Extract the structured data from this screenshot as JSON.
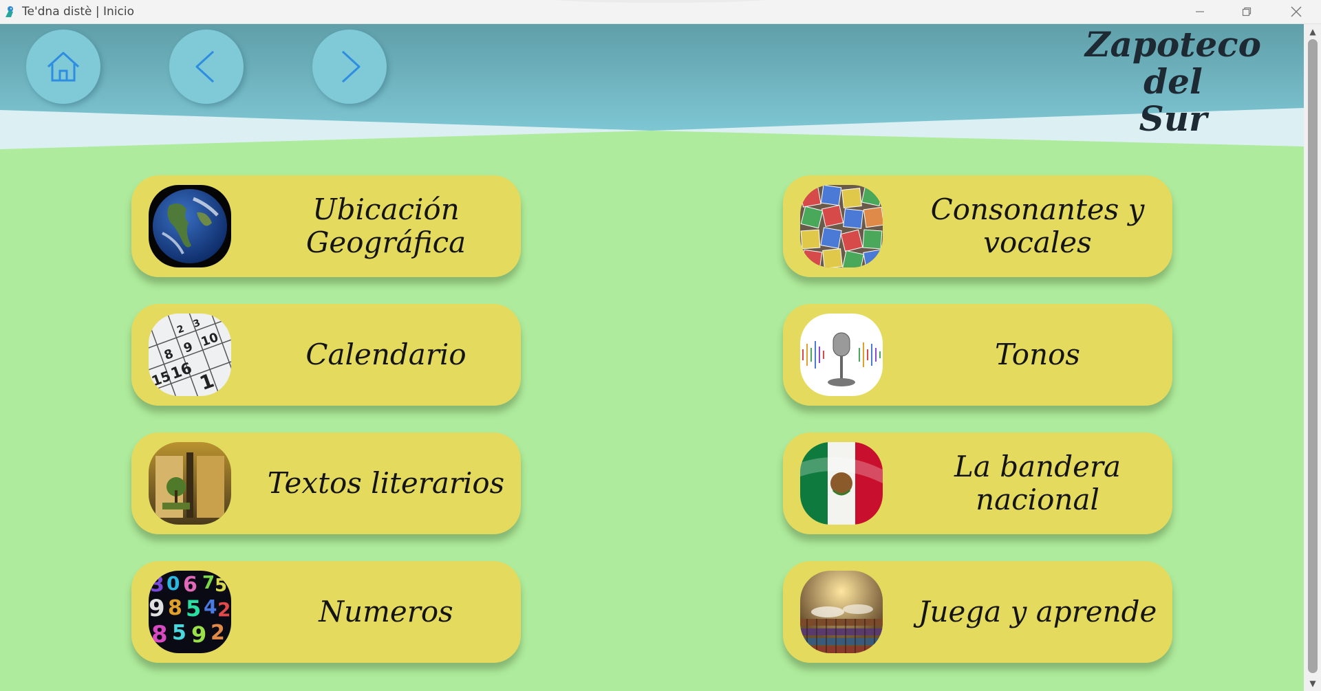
{
  "window": {
    "title": "Te'dna distè | Inicio",
    "app_icon": "bird-icon",
    "controls": [
      "minimize-icon",
      "restore-icon",
      "close-icon"
    ]
  },
  "header": {
    "app_title_line1": "Zapoteco del",
    "app_title_line2": "Sur",
    "nav": [
      {
        "name": "home-icon"
      },
      {
        "name": "back-arrow-icon"
      },
      {
        "name": "forward-arrow-icon"
      }
    ],
    "colors": {
      "header_top": "#5f9fa9",
      "header_bottom": "#7ec6d3",
      "accent_icon": "#2e8de0"
    }
  },
  "menu": {
    "left": [
      {
        "label_line1": "Ubicación",
        "label_line2": "Geográfica",
        "image": "earth-globe"
      },
      {
        "label_line1": "Calendario",
        "label_line2": "",
        "image": "calendar-page"
      },
      {
        "label_line1": "Textos literarios",
        "label_line2": "",
        "image": "open-book"
      },
      {
        "label_line1": "Numeros",
        "label_line2": "",
        "image": "colorful-numbers"
      }
    ],
    "right": [
      {
        "label_line1": "Consonantes y",
        "label_line2": "vocales",
        "image": "letter-blocks"
      },
      {
        "label_line1": "Tonos",
        "label_line2": "",
        "image": "microphone-soundwave"
      },
      {
        "label_line1": "La bandera",
        "label_line2": "nacional",
        "image": "mexican-flag"
      },
      {
        "label_line1": "Juega y aprende",
        "label_line2": "",
        "image": "library-books"
      }
    ]
  },
  "colors": {
    "background": "#aeeb9c",
    "card": "#e4db5e",
    "text": "#141414"
  }
}
